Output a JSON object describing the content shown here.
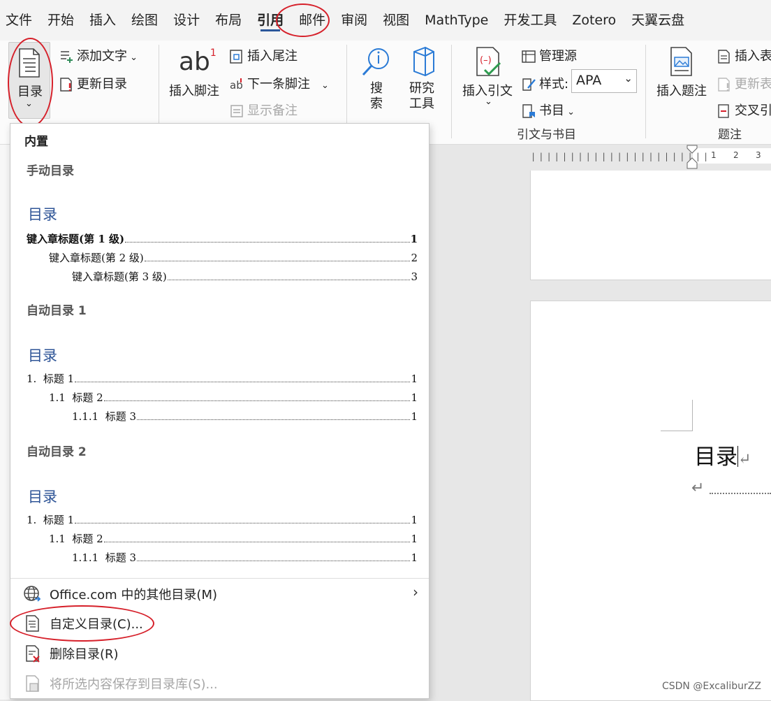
{
  "menu_tabs": [
    "文件",
    "开始",
    "插入",
    "绘图",
    "设计",
    "布局",
    "引用",
    "邮件",
    "审阅",
    "视图",
    "MathType",
    "开发工具",
    "Zotero",
    "天翼云盘"
  ],
  "ribbon": {
    "toc_button": "目录",
    "add_text": "添加文字",
    "update_toc": "更新目录",
    "insert_footnote": "插入脚注",
    "insert_endnote": "插入尾注",
    "next_footnote": "下一条脚注",
    "show_notes": "显示备注",
    "search": "搜索",
    "researcher": "研究工具",
    "insert_citation": "插入引文",
    "manage_sources": "管理源",
    "style_label": "样式:",
    "style_value": "APA",
    "bibliography": "书目",
    "group_citations": "引文与书目",
    "insert_caption": "插入题注",
    "insert_table_figures": "插入表",
    "update_table": "更新表",
    "cross_reference": "交叉引",
    "group_captions": "题注",
    "ab_icon_text": "ab",
    "ab_superscript": "1"
  },
  "dropdown": {
    "section_builtin": "内置",
    "manual_toc": {
      "name": "手动目录",
      "preview_title": "目录",
      "lines": [
        {
          "text": "键入章标题(第 1 级)",
          "page": "1"
        },
        {
          "text": "键入章标题(第 2 级)",
          "page": "2"
        },
        {
          "text": "键入章标题(第 3 级)",
          "page": "3"
        }
      ]
    },
    "auto_toc_1": {
      "name": "自动目录 1",
      "preview_title": "目录",
      "lines": [
        {
          "text": "1.  标题 1",
          "page": "1"
        },
        {
          "text": "1.1  标题 2",
          "page": "1"
        },
        {
          "text": "1.1.1  标题 3",
          "page": "1"
        }
      ]
    },
    "auto_toc_2": {
      "name": "自动目录 2",
      "preview_title": "目录",
      "lines": [
        {
          "text": "1.  标题 1",
          "page": "1"
        },
        {
          "text": "1.1  标题 2",
          "page": "1"
        },
        {
          "text": "1.1.1  标题 3",
          "page": "1"
        }
      ]
    },
    "commands": {
      "office_more": "Office.com 中的其他目录(M)",
      "custom_toc": "自定义目录(C)...",
      "remove_toc": "删除目录(R)",
      "save_selection": "将所选内容保存到目录库(S)..."
    }
  },
  "document": {
    "title_text": "目录",
    "ruler_numbers": [
      "1",
      "2",
      "3"
    ]
  },
  "watermark": "CSDN @ExcaliburZZ",
  "colors": {
    "accent": "#2b579a",
    "annotation_red": "#d6202a",
    "toc_title_blue": "#2f5597"
  }
}
